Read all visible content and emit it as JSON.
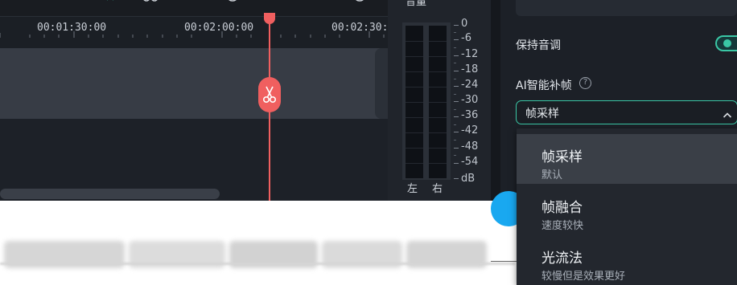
{
  "timeline": {
    "toolbar_icons": [
      "cursor-icon",
      "music-note-icon",
      "highlight-icon",
      "audio-split-icon",
      "crop-icon",
      "clock-icon",
      "dot-icon",
      "speed-icon"
    ],
    "ruler_labels": [
      "00:01:30:00",
      "00:02:00:00",
      "00:02:30:0"
    ]
  },
  "meter": {
    "title": "音量",
    "db_labels": [
      "0",
      "-6",
      "-12",
      "-18",
      "-24",
      "-30",
      "-36",
      "-42",
      "-48",
      "-54",
      "dB"
    ],
    "channels": [
      "左",
      "右"
    ]
  },
  "panel": {
    "keep_pitch_label": "保持音调",
    "keep_pitch_on": true,
    "ai_frame_label": "AI智能补帧",
    "help_icon": "?",
    "select_value": "帧采样"
  },
  "dropdown": {
    "options": [
      {
        "title": "帧采样",
        "subtitle": "默认",
        "selected": true
      },
      {
        "title": "帧融合",
        "subtitle": "速度较快",
        "selected": false
      },
      {
        "title": "光流法",
        "subtitle": "较慢但是效果更好",
        "selected": false
      }
    ]
  },
  "colors": {
    "accent": "#3ac7a5",
    "playhead": "#f05f5f",
    "panel_bg": "#1c2027"
  }
}
